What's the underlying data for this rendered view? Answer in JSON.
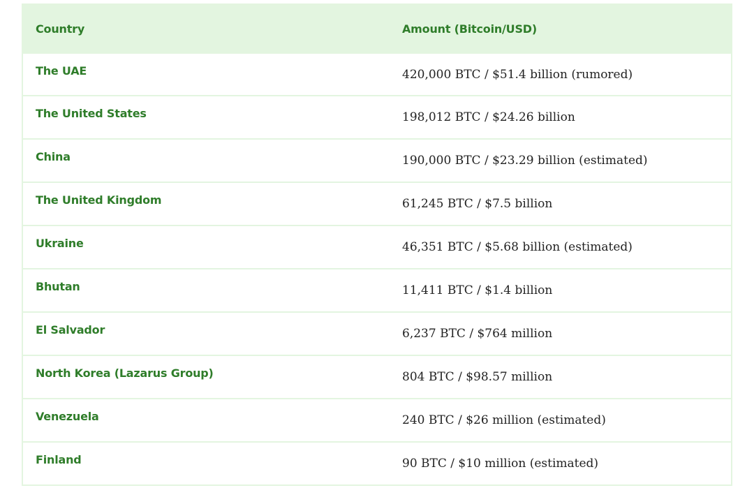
{
  "table": {
    "headers": {
      "country": "Country",
      "amount": "Amount (Bitcoin/USD)"
    },
    "rows": [
      {
        "country": "The UAE",
        "amount": "420,000 BTC / $51.4 billion (rumored)"
      },
      {
        "country": "The United States",
        "amount": "198,012 BTC / $24.26 billion"
      },
      {
        "country": "China",
        "amount": "190,000 BTC / $23.29 billion (estimated)"
      },
      {
        "country": "The United Kingdom",
        "amount": "61,245 BTC / $7.5 billion"
      },
      {
        "country": "Ukraine",
        "amount": "46,351 BTC / $5.68 billion (estimated)"
      },
      {
        "country": "Bhutan",
        "amount": "11,411 BTC / $1.4 billion"
      },
      {
        "country": "El Salvador",
        "amount": "6,237 BTC / $764 million"
      },
      {
        "country": "North Korea (Lazarus Group)",
        "amount": "804 BTC / $98.57 million"
      },
      {
        "country": "Venezuela",
        "amount": "240 BTC / $26 million (estimated)"
      },
      {
        "country": "Finland",
        "amount": "90 BTC / $10 million (estimated)"
      }
    ]
  },
  "colors": {
    "header_bg": "#e3f5e0",
    "accent_text": "#2f7d2a",
    "body_text": "#222222"
  }
}
